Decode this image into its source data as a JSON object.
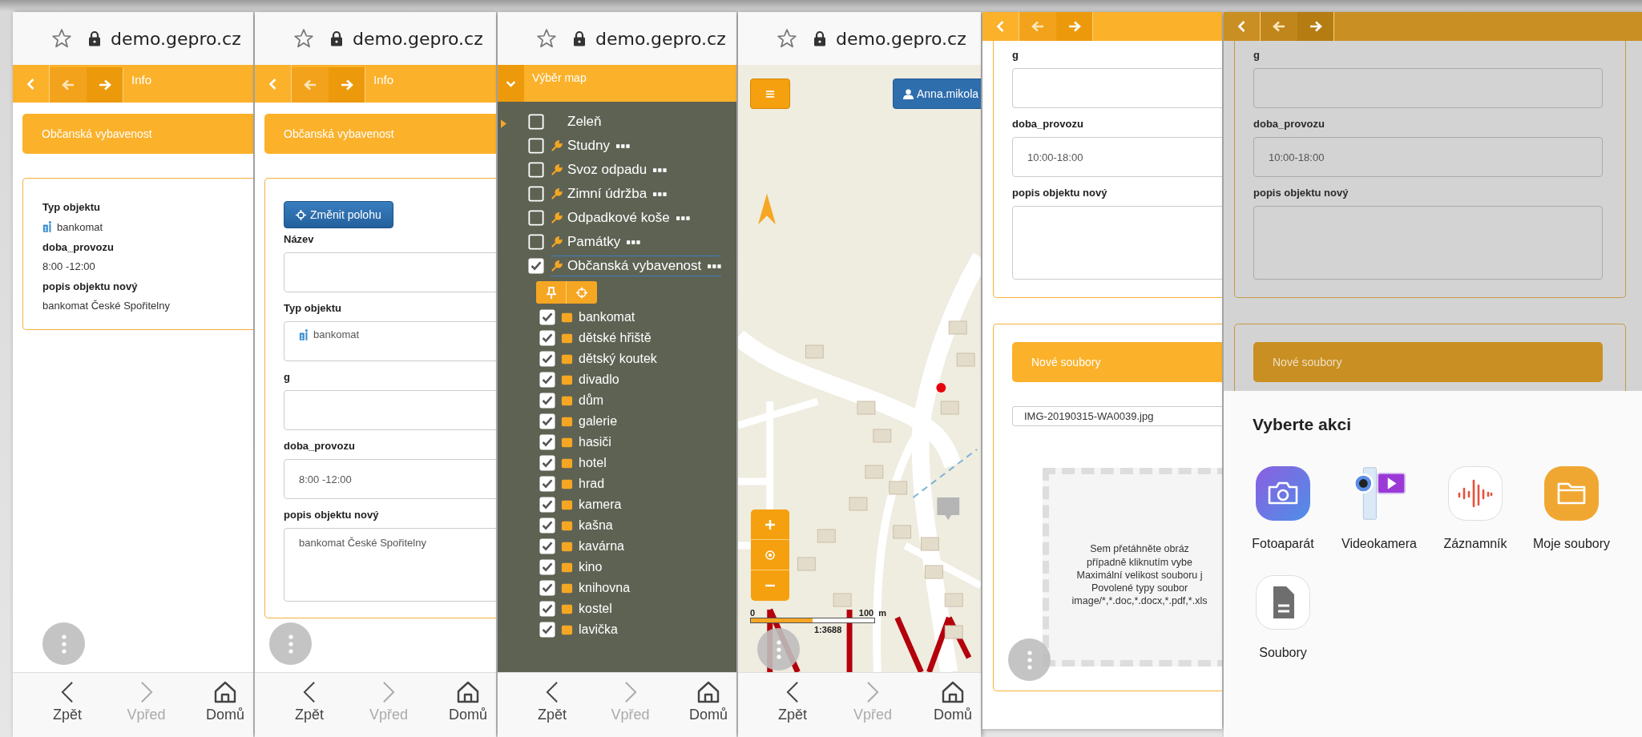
{
  "panels": [
    {
      "kind": "detail",
      "url": "demo.gepro.cz",
      "header_title": "Info",
      "section": "Občanská vybavenost",
      "fields": [
        {
          "kind": "type",
          "label": "Typ objektu",
          "value": "bankomat"
        },
        {
          "kind": "text",
          "label": "doba_provozu",
          "value": "8:00 -12:00"
        },
        {
          "kind": "text",
          "label": "popis objektu nový",
          "value": "bankomat České Spořitelny"
        }
      ],
      "bottom_nav": [
        {
          "kind": "back",
          "label": "Zpět",
          "disabled": false
        },
        {
          "kind": "forward",
          "label": "Vpřed",
          "disabled": true
        },
        {
          "kind": "home",
          "label": "Domů",
          "disabled": false
        }
      ]
    },
    {
      "kind": "form",
      "url": "demo.gepro.cz",
      "header_title": "Info",
      "section": "Občanská vybavenost",
      "action_button": "Změnit polohu",
      "fields": [
        {
          "kind": "input",
          "label": "Název"
        },
        {
          "kind": "type",
          "label": "Typ objektu",
          "value": "bankomat"
        },
        {
          "kind": "input",
          "label": "g"
        },
        {
          "kind": "input",
          "label": "doba_provozu",
          "value": "8:00 -12:00"
        },
        {
          "kind": "textarea",
          "label": "popis objektu nový",
          "value": "bankomat České Spořitelny"
        }
      ],
      "bottom_nav": [
        {
          "kind": "back",
          "label": "Zpět",
          "disabled": false
        },
        {
          "kind": "forward",
          "label": "Vpřed",
          "disabled": true
        },
        {
          "kind": "home",
          "label": "Domů",
          "disabled": false
        }
      ]
    },
    {
      "kind": "layers",
      "url": "demo.gepro.cz",
      "header_title": "Výběr map",
      "layers": [
        {
          "kind": "plain",
          "label": "Zeleň",
          "checked": false,
          "selected": false,
          "has_menu": false
        },
        {
          "kind": "tool",
          "label": "Studny",
          "checked": false,
          "selected": false,
          "has_menu": true
        },
        {
          "kind": "tool",
          "label": "Svoz odpadu",
          "checked": false,
          "selected": false,
          "has_menu": true
        },
        {
          "kind": "tool",
          "label": "Zimní údržba",
          "checked": false,
          "selected": false,
          "has_menu": true
        },
        {
          "kind": "tool",
          "label": "Odpadkové koše",
          "checked": false,
          "selected": false,
          "has_menu": true
        },
        {
          "kind": "tool",
          "label": "Památky",
          "checked": false,
          "selected": false,
          "has_menu": true
        },
        {
          "kind": "tool",
          "label": "Občanská vybavenost",
          "checked": true,
          "selected": true,
          "has_menu": true
        }
      ],
      "sublayers": [
        {
          "label": "bankomat",
          "checked": true
        },
        {
          "label": "dětské hřiště",
          "checked": true
        },
        {
          "label": "dětský koutek",
          "checked": true
        },
        {
          "label": "divadlo",
          "checked": true
        },
        {
          "label": "dům",
          "checked": true
        },
        {
          "label": "galerie",
          "checked": true
        },
        {
          "label": "hasiči",
          "checked": true
        },
        {
          "label": "hotel",
          "checked": true
        },
        {
          "label": "hrad",
          "checked": true
        },
        {
          "label": "kamera",
          "checked": true
        },
        {
          "label": "kašna",
          "checked": true
        },
        {
          "label": "kavárna",
          "checked": true
        },
        {
          "label": "kino",
          "checked": true
        },
        {
          "label": "knihovna",
          "checked": true
        },
        {
          "label": "kostel",
          "checked": true
        },
        {
          "label": "lavička",
          "checked": true
        }
      ],
      "bottom_nav": [
        {
          "kind": "back",
          "label": "Zpět",
          "disabled": false
        },
        {
          "kind": "forward",
          "label": "Vpřed",
          "disabled": true
        },
        {
          "kind": "home",
          "label": "Domů",
          "disabled": false
        }
      ]
    },
    {
      "kind": "map",
      "url": "demo.gepro.cz",
      "user_button": "Anna.mikola",
      "scale": {
        "start": "0",
        "end": "100",
        "unit": "m",
        "ratio": "1:3688"
      },
      "bottom_nav": [
        {
          "kind": "back",
          "label": "Zpět",
          "disabled": false
        },
        {
          "kind": "forward",
          "label": "Vpřed",
          "disabled": true
        },
        {
          "kind": "home",
          "label": "Domů",
          "disabled": false
        }
      ]
    },
    {
      "kind": "files",
      "fields": [
        {
          "kind": "input",
          "label": "g"
        },
        {
          "kind": "input",
          "label": "doba_provozu",
          "value": "10:00-18:00"
        },
        {
          "kind": "textarea",
          "label": "popis objektu nový"
        }
      ],
      "files_title": "Nové soubory",
      "file": "IMG-20190315-WA0039.jpg",
      "dropzone_lines": [
        "Sem přetáhněte obráz",
        "případně kliknutím vybe",
        "Maximální velikost souboru j",
        "Povolené typy soubor",
        "image/*,*.doc,*.docx,*.pdf,*.xls"
      ]
    },
    {
      "kind": "sheet",
      "fields": [
        {
          "kind": "input",
          "label": "g"
        },
        {
          "kind": "input",
          "label": "doba_provozu",
          "value": "10:00-18:00"
        },
        {
          "kind": "textarea",
          "label": "popis objektu nový"
        }
      ],
      "files_title": "Nové soubory",
      "sheet_title": "Vyberte akci",
      "apps": [
        {
          "kind": "camera",
          "label": "Fotoaparát"
        },
        {
          "kind": "video",
          "label": "Videokamera"
        },
        {
          "kind": "recorder",
          "label": "Záznamník"
        },
        {
          "kind": "folder",
          "label": "Moje soubory"
        },
        {
          "kind": "file",
          "label": "Soubory"
        }
      ]
    }
  ]
}
